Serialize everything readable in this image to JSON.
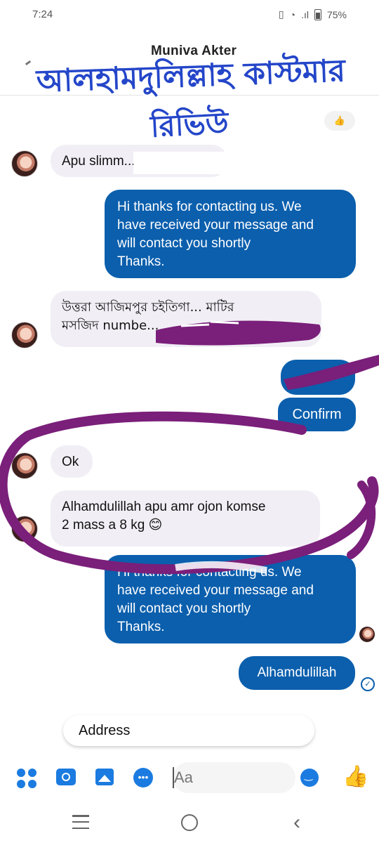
{
  "status_bar": {
    "time": "7:24",
    "battery": "75%"
  },
  "header": {
    "contact_name": "Muniva Akter"
  },
  "overlay_banner": {
    "line1": "আলহামদুলিল্লাহ কাস্টমার",
    "line2": "রিভিউ",
    "color": "#2446c9"
  },
  "messages": [
    {
      "side": "in",
      "text": "Apu slimm..."
    },
    {
      "side": "out",
      "lines": [
        "Hi thanks for contacting us. We",
        "have received your message and",
        "will contact you shortly",
        "Thanks."
      ]
    },
    {
      "side": "in",
      "lines": [
        "উত্তরা আজিমপুর চইতিগা... মাটির",
        "মসজিদ numbe..."
      ]
    },
    {
      "side": "out",
      "text": "Confirm"
    },
    {
      "side": "in",
      "text": "Ok"
    },
    {
      "side": "in",
      "lines": [
        "Alhamdulillah apu amr ojon komse",
        "2 mass a 8 kg 😊"
      ]
    },
    {
      "side": "out",
      "lines": [
        "Hi thanks for contacting us. We",
        "have received your message and",
        "will contact you shortly",
        "Thanks."
      ]
    },
    {
      "side": "out",
      "text": "Alhamdulillah"
    }
  ],
  "quick_reply": {
    "label": "Address"
  },
  "composer": {
    "placeholder": "Aa",
    "icons": [
      "apps-icon",
      "camera-icon",
      "gallery-icon",
      "messenger-chat-icon",
      "emoji-icon",
      "thumbs-up-icon"
    ]
  },
  "colors": {
    "outgoing_bubble": "#0b5fad",
    "incoming_bubble": "#f1eff5",
    "accent": "#1b7be0",
    "scribble": "#7a1f7a"
  }
}
